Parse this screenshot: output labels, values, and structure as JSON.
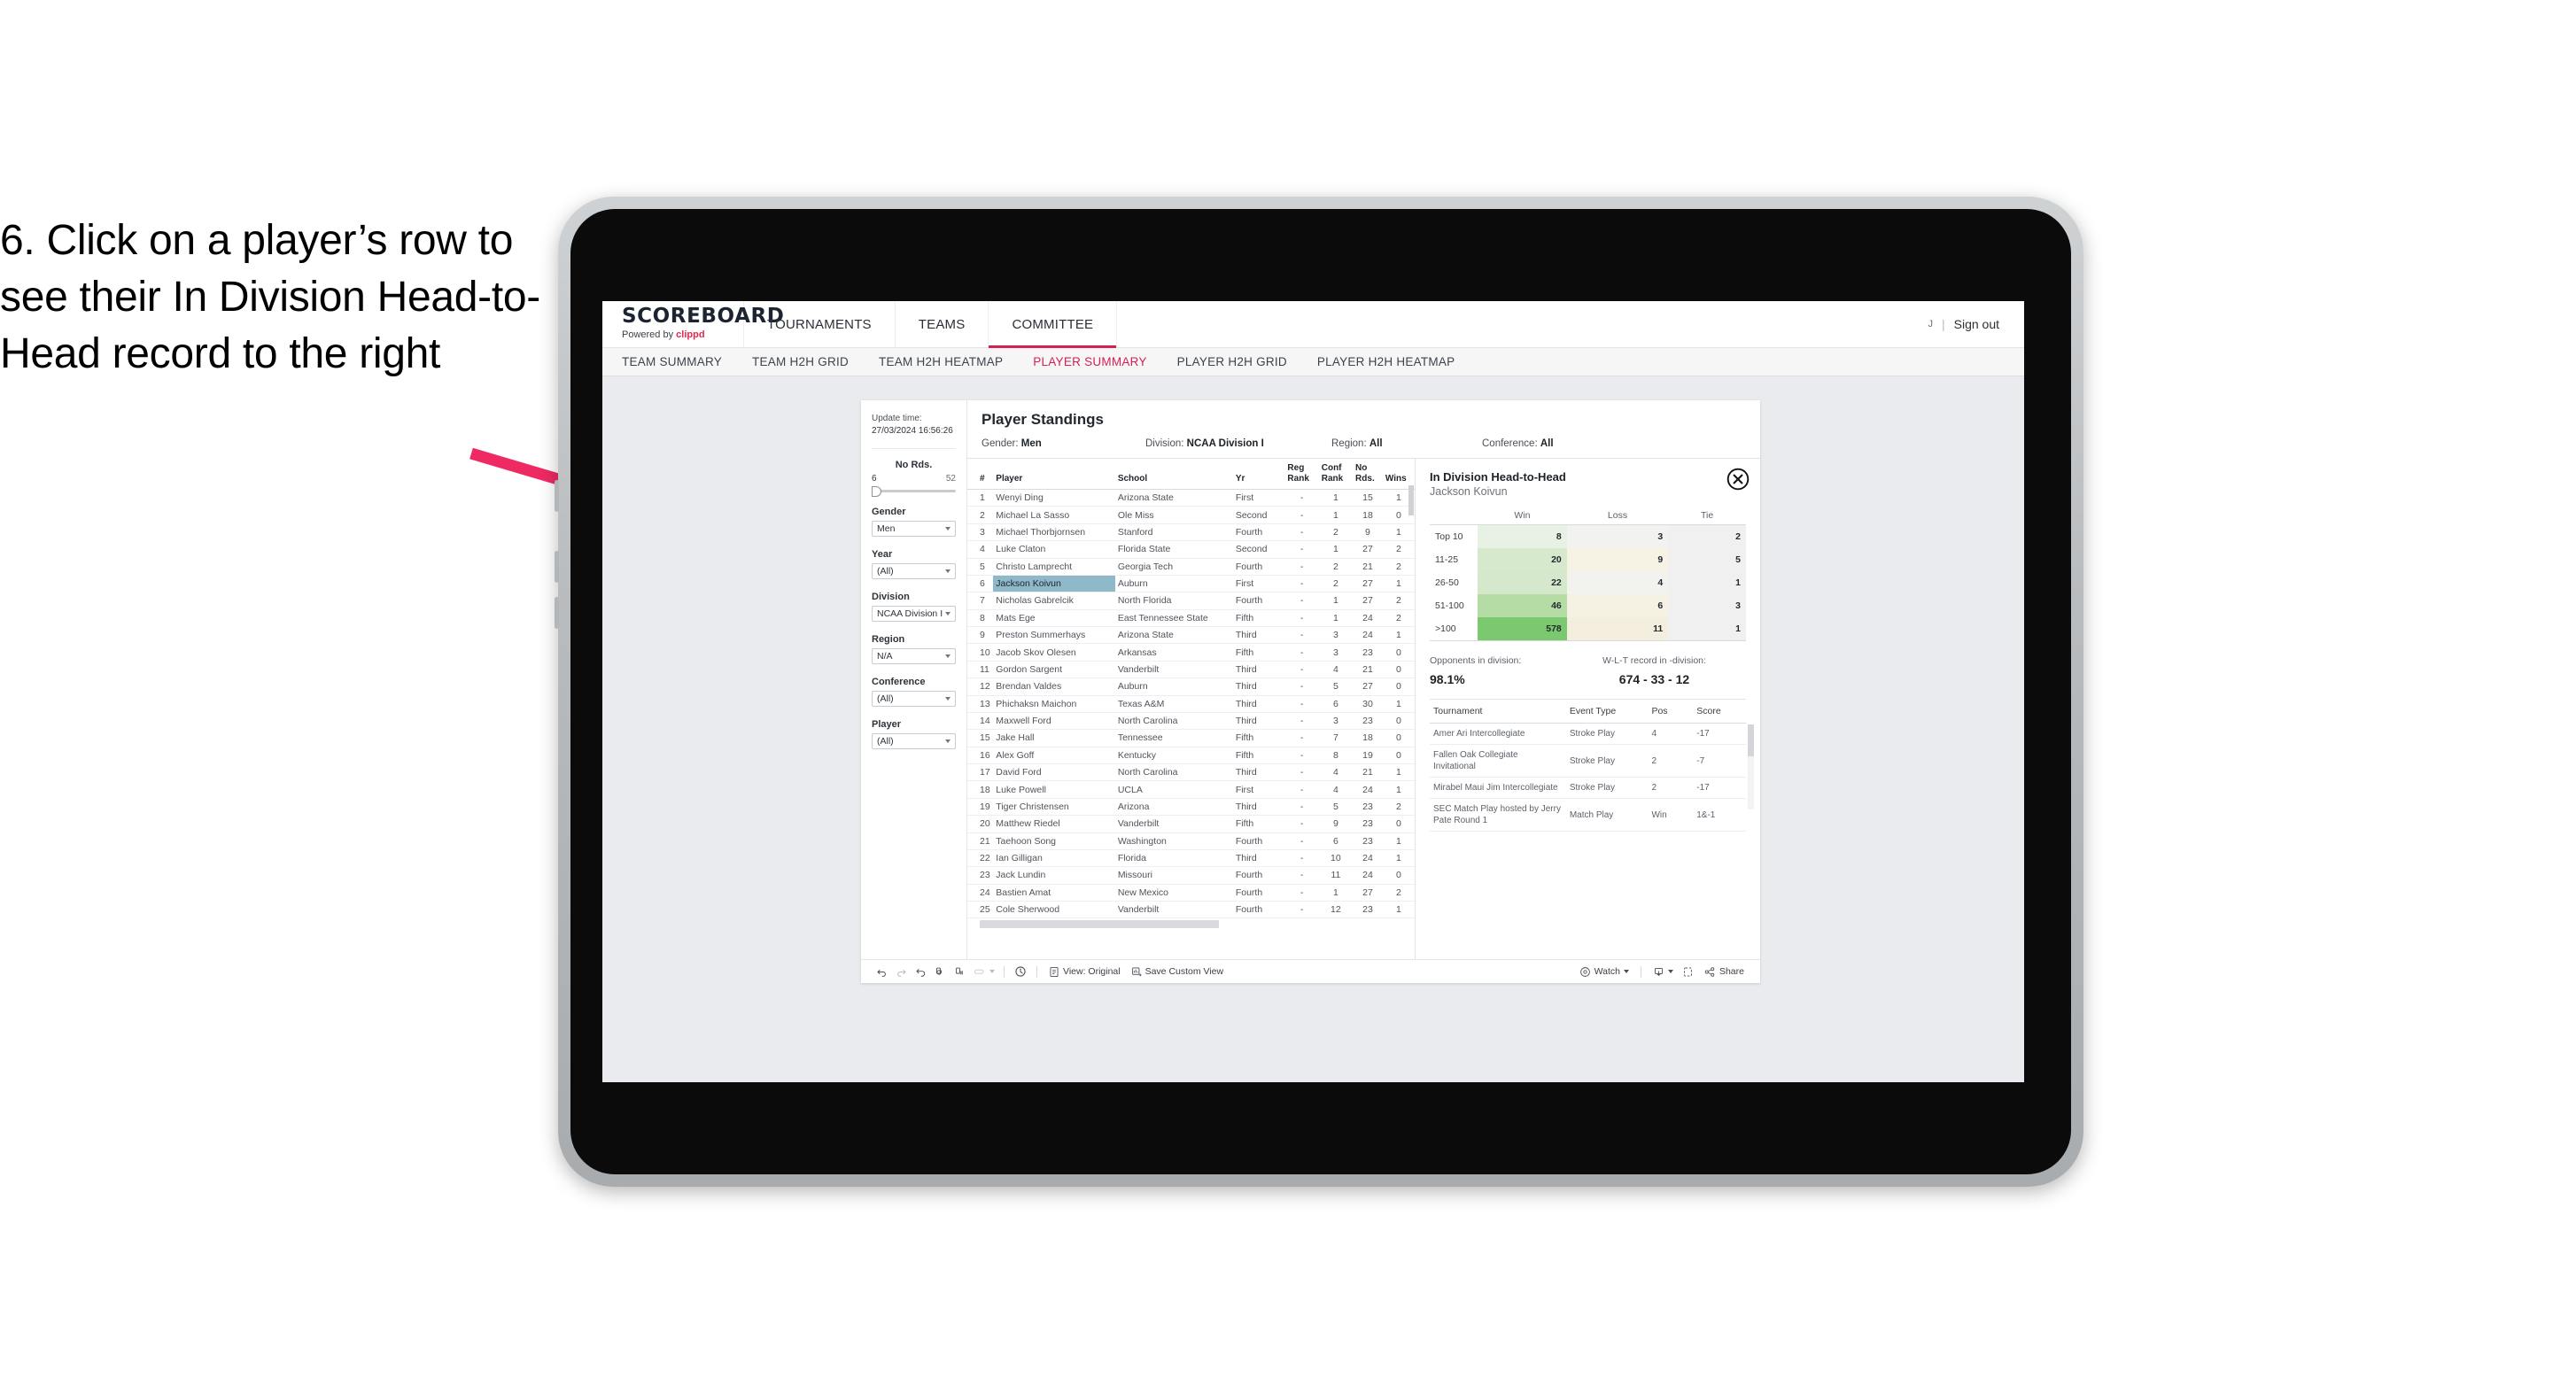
{
  "instruction": "6. Click on a player’s row to see their In Division Head-to-Head record to the right",
  "header": {
    "brand_title": "SCOREBOARD",
    "brand_sub_prefix": "Powered by ",
    "brand_sub_name": "clippd",
    "nav": [
      {
        "label": "TOURNAMENTS",
        "active": false
      },
      {
        "label": "TEAMS",
        "active": false
      },
      {
        "label": "COMMITTEE",
        "active": true
      }
    ],
    "user_initial": "J",
    "separator": "|",
    "signout": "Sign out"
  },
  "subtabs": [
    {
      "label": "TEAM SUMMARY",
      "active": false
    },
    {
      "label": "TEAM H2H GRID",
      "active": false
    },
    {
      "label": "TEAM H2H HEATMAP",
      "active": false
    },
    {
      "label": "PLAYER SUMMARY",
      "active": true
    },
    {
      "label": "PLAYER H2H GRID",
      "active": false
    },
    {
      "label": "PLAYER H2H HEATMAP",
      "active": false
    }
  ],
  "filters": {
    "update_time_label": "Update time:",
    "update_time_value": "27/03/2024 16:56:26",
    "slider": {
      "title": "No Rds.",
      "min": "6",
      "max": "52"
    },
    "groups": [
      {
        "label": "Gender",
        "value": "Men"
      },
      {
        "label": "Year",
        "value": "(All)"
      },
      {
        "label": "Division",
        "value": "NCAA Division I"
      },
      {
        "label": "Region",
        "value": "N/A"
      },
      {
        "label": "Conference",
        "value": "(All)"
      },
      {
        "label": "Player",
        "value": "(All)"
      }
    ]
  },
  "standings": {
    "title": "Player Standings",
    "meta": [
      {
        "label": "Gender:",
        "value": "Men"
      },
      {
        "label": "Division:",
        "value": "NCAA Division I"
      },
      {
        "label": "Region:",
        "value": "All"
      },
      {
        "label": "Conference:",
        "value": "All"
      }
    ],
    "columns": [
      "#",
      "Player",
      "School",
      "Yr",
      "Reg Rank",
      "Conf Rank",
      "No Rds.",
      "Wins"
    ],
    "rows": [
      {
        "rank": "1",
        "player": "Wenyi Ding",
        "school": "Arizona State",
        "yr": "First",
        "reg": "-",
        "conf": "1",
        "no": "15",
        "wins": "1",
        "selected": false
      },
      {
        "rank": "2",
        "player": "Michael La Sasso",
        "school": "Ole Miss",
        "yr": "Second",
        "reg": "-",
        "conf": "1",
        "no": "18",
        "wins": "0",
        "selected": false
      },
      {
        "rank": "3",
        "player": "Michael Thorbjornsen",
        "school": "Stanford",
        "yr": "Fourth",
        "reg": "-",
        "conf": "2",
        "no": "9",
        "wins": "1",
        "selected": false
      },
      {
        "rank": "4",
        "player": "Luke Claton",
        "school": "Florida State",
        "yr": "Second",
        "reg": "-",
        "conf": "1",
        "no": "27",
        "wins": "2",
        "selected": false
      },
      {
        "rank": "5",
        "player": "Christo Lamprecht",
        "school": "Georgia Tech",
        "yr": "Fourth",
        "reg": "-",
        "conf": "2",
        "no": "21",
        "wins": "2",
        "selected": false
      },
      {
        "rank": "6",
        "player": "Jackson Koivun",
        "school": "Auburn",
        "yr": "First",
        "reg": "-",
        "conf": "2",
        "no": "27",
        "wins": "1",
        "selected": true
      },
      {
        "rank": "7",
        "player": "Nicholas Gabrelcik",
        "school": "North Florida",
        "yr": "Fourth",
        "reg": "-",
        "conf": "1",
        "no": "27",
        "wins": "2",
        "selected": false
      },
      {
        "rank": "8",
        "player": "Mats Ege",
        "school": "East Tennessee State",
        "yr": "Fifth",
        "reg": "-",
        "conf": "1",
        "no": "24",
        "wins": "2",
        "selected": false
      },
      {
        "rank": "9",
        "player": "Preston Summerhays",
        "school": "Arizona State",
        "yr": "Third",
        "reg": "-",
        "conf": "3",
        "no": "24",
        "wins": "1",
        "selected": false
      },
      {
        "rank": "10",
        "player": "Jacob Skov Olesen",
        "school": "Arkansas",
        "yr": "Fifth",
        "reg": "-",
        "conf": "3",
        "no": "23",
        "wins": "0",
        "selected": false
      },
      {
        "rank": "11",
        "player": "Gordon Sargent",
        "school": "Vanderbilt",
        "yr": "Third",
        "reg": "-",
        "conf": "4",
        "no": "21",
        "wins": "0",
        "selected": false
      },
      {
        "rank": "12",
        "player": "Brendan Valdes",
        "school": "Auburn",
        "yr": "Third",
        "reg": "-",
        "conf": "5",
        "no": "27",
        "wins": "0",
        "selected": false
      },
      {
        "rank": "13",
        "player": "Phichaksn Maichon",
        "school": "Texas A&M",
        "yr": "Third",
        "reg": "-",
        "conf": "6",
        "no": "30",
        "wins": "1",
        "selected": false
      },
      {
        "rank": "14",
        "player": "Maxwell Ford",
        "school": "North Carolina",
        "yr": "Third",
        "reg": "-",
        "conf": "3",
        "no": "23",
        "wins": "0",
        "selected": false
      },
      {
        "rank": "15",
        "player": "Jake Hall",
        "school": "Tennessee",
        "yr": "Fifth",
        "reg": "-",
        "conf": "7",
        "no": "18",
        "wins": "0",
        "selected": false
      },
      {
        "rank": "16",
        "player": "Alex Goff",
        "school": "Kentucky",
        "yr": "Fifth",
        "reg": "-",
        "conf": "8",
        "no": "19",
        "wins": "0",
        "selected": false
      },
      {
        "rank": "17",
        "player": "David Ford",
        "school": "North Carolina",
        "yr": "Third",
        "reg": "-",
        "conf": "4",
        "no": "21",
        "wins": "1",
        "selected": false
      },
      {
        "rank": "18",
        "player": "Luke Powell",
        "school": "UCLA",
        "yr": "First",
        "reg": "-",
        "conf": "4",
        "no": "24",
        "wins": "1",
        "selected": false
      },
      {
        "rank": "19",
        "player": "Tiger Christensen",
        "school": "Arizona",
        "yr": "Third",
        "reg": "-",
        "conf": "5",
        "no": "23",
        "wins": "2",
        "selected": false
      },
      {
        "rank": "20",
        "player": "Matthew Riedel",
        "school": "Vanderbilt",
        "yr": "Fifth",
        "reg": "-",
        "conf": "9",
        "no": "23",
        "wins": "0",
        "selected": false
      },
      {
        "rank": "21",
        "player": "Taehoon Song",
        "school": "Washington",
        "yr": "Fourth",
        "reg": "-",
        "conf": "6",
        "no": "23",
        "wins": "1",
        "selected": false
      },
      {
        "rank": "22",
        "player": "Ian Gilligan",
        "school": "Florida",
        "yr": "Third",
        "reg": "-",
        "conf": "10",
        "no": "24",
        "wins": "1",
        "selected": false
      },
      {
        "rank": "23",
        "player": "Jack Lundin",
        "school": "Missouri",
        "yr": "Fourth",
        "reg": "-",
        "conf": "11",
        "no": "24",
        "wins": "0",
        "selected": false
      },
      {
        "rank": "24",
        "player": "Bastien Amat",
        "school": "New Mexico",
        "yr": "Fourth",
        "reg": "-",
        "conf": "1",
        "no": "27",
        "wins": "2",
        "selected": false
      },
      {
        "rank": "25",
        "player": "Cole Sherwood",
        "school": "Vanderbilt",
        "yr": "Fourth",
        "reg": "-",
        "conf": "12",
        "no": "23",
        "wins": "1",
        "selected": false
      }
    ]
  },
  "h2h": {
    "title": "In Division Head-to-Head",
    "player": "Jackson Koivun",
    "close_icon": "close-circle-icon",
    "columns": [
      "",
      "Win",
      "Loss",
      "Tie"
    ],
    "rows": [
      {
        "band": "Top 10",
        "win": "8",
        "loss": "3",
        "tie": "2",
        "win_color": "#e8f2e4",
        "loss_color": "#f2f2f0",
        "tie_color": "#f0f0f0"
      },
      {
        "band": "11-25",
        "win": "20",
        "loss": "9",
        "tie": "5",
        "win_color": "#d7e9cd",
        "loss_color": "#f6f2e4",
        "tie_color": "#f0f0f0"
      },
      {
        "band": "26-50",
        "win": "22",
        "loss": "4",
        "tie": "1",
        "win_color": "#d6e8cc",
        "loss_color": "#f2f2ef",
        "tie_color": "#f0f0f0"
      },
      {
        "band": "51-100",
        "win": "46",
        "loss": "6",
        "tie": "3",
        "win_color": "#b6dca6",
        "loss_color": "#f5f1e3",
        "tie_color": "#f0f0f0"
      },
      {
        "band": ">100",
        "win": "578",
        "loss": "11",
        "tie": "1",
        "win_color": "#7bc96f",
        "loss_color": "#f3eedd",
        "tie_color": "#f0f0f0"
      }
    ],
    "stats": [
      {
        "caption": "Opponents in division:",
        "value": "98.1%"
      },
      {
        "caption": "W-L-T record in -division:",
        "value": "674 - 33 - 12"
      }
    ],
    "tournament_columns": [
      "Tournament",
      "Event Type",
      "Pos",
      "Score"
    ],
    "tournaments": [
      {
        "name": "Amer Ari Intercollegiate",
        "type": "Stroke Play",
        "pos": "4",
        "score": "-17"
      },
      {
        "name": "Fallen Oak Collegiate Invitational",
        "type": "Stroke Play",
        "pos": "2",
        "score": "-7"
      },
      {
        "name": "Mirabel Maui Jim Intercollegiate",
        "type": "Stroke Play",
        "pos": "2",
        "score": "-17"
      },
      {
        "name": "SEC Match Play hosted by Jerry Pate Round 1",
        "type": "Match Play",
        "pos": "Win",
        "score": "1&-1"
      }
    ]
  },
  "toolbar": {
    "icons": [
      "undo-icon",
      "redo-icon",
      "revert-icon",
      "refresh-data-icon",
      "pause-updates-icon",
      "highlight-icon"
    ],
    "alerts_icon": "alerts-clock-icon",
    "view_icon": "view-icon",
    "view_label": "View: Original",
    "save_icon": "save-custom-view-icon",
    "save_label": "Save Custom View",
    "watch_icon": "watch-icon",
    "watch_label": "Watch",
    "download_icon": "download-icon",
    "fullscreen_icon": "fullscreen-icon",
    "share_icon": "share-icon",
    "share_label": "Share"
  },
  "colors": {
    "accent": "#d81f54",
    "arrow": "#ef2a63",
    "selected_row": "#8fb8c9"
  }
}
